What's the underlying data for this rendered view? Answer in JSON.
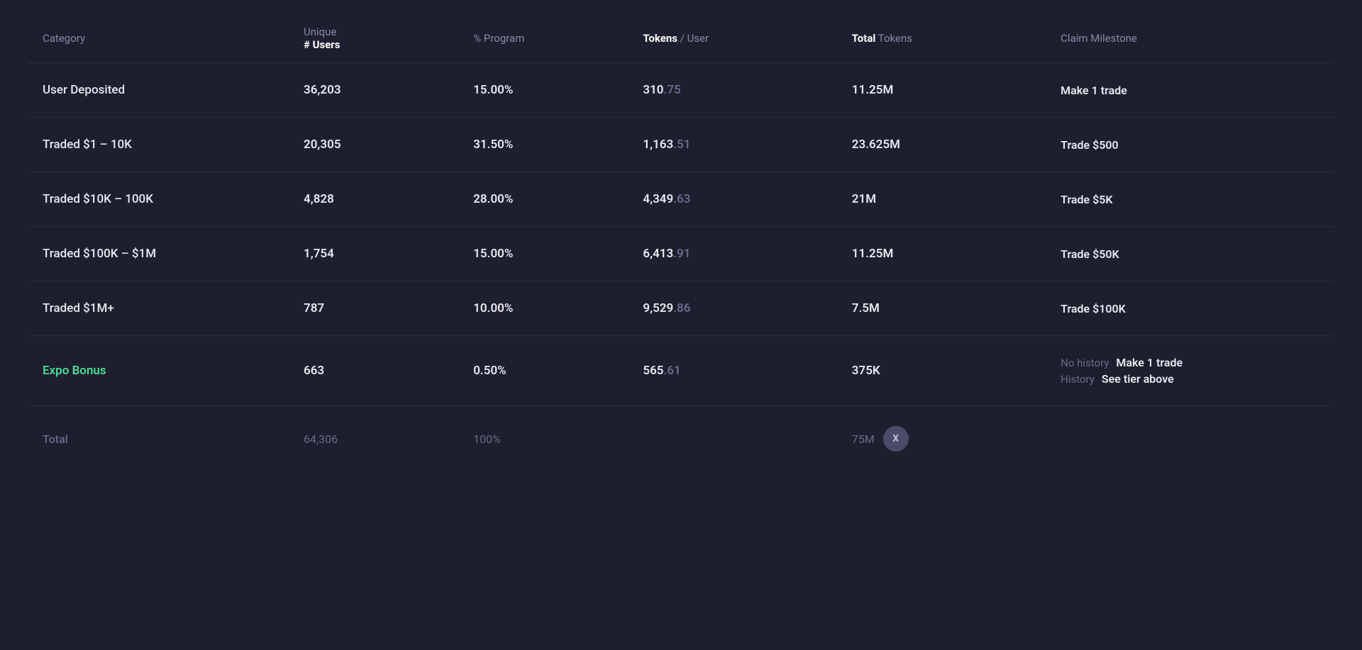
{
  "header": {
    "col1": "Category",
    "col2_line1": "Unique",
    "col2_line2": "# Users",
    "col3": "% Program",
    "col4_bold": "Tokens",
    "col4_rest": " / User",
    "col5_bold": "Total",
    "col5_rest": " Tokens",
    "col6": "Claim Milestone"
  },
  "rows": [
    {
      "category": "User Deposited",
      "isExpo": false,
      "users": "36,203",
      "program": "15.00%",
      "tokens_main": "310",
      "tokens_decimal": ".75",
      "total": "11.25M",
      "milestone": "Make 1 trade",
      "milestone_type": "simple"
    },
    {
      "category": "Traded $1 – 10K",
      "isExpo": false,
      "users": "20,305",
      "program": "31.50%",
      "tokens_main": "1,163",
      "tokens_decimal": ".51",
      "total": "23.625M",
      "milestone": "Trade $500",
      "milestone_type": "simple"
    },
    {
      "category": "Traded $10K – 100K",
      "isExpo": false,
      "users": "4,828",
      "program": "28.00%",
      "tokens_main": "4,349",
      "tokens_decimal": ".63",
      "total": "21M",
      "milestone": "Trade $5K",
      "milestone_type": "simple"
    },
    {
      "category": "Traded $100K – $1M",
      "isExpo": false,
      "users": "1,754",
      "program": "15.00%",
      "tokens_main": "6,413",
      "tokens_decimal": ".91",
      "total": "11.25M",
      "milestone": "Trade $50K",
      "milestone_type": "simple"
    },
    {
      "category": "Traded $1M+",
      "isExpo": false,
      "users": "787",
      "program": "10.00%",
      "tokens_main": "9,529",
      "tokens_decimal": ".86",
      "total": "7.5M",
      "milestone": "Trade $100K",
      "milestone_type": "simple"
    },
    {
      "category": "Expo Bonus",
      "isExpo": true,
      "users": "663",
      "program": "0.50%",
      "tokens_main": "565",
      "tokens_decimal": ".61",
      "total": "375K",
      "milestone_type": "expo",
      "milestone_no_history_label": "No history",
      "milestone_no_history_value": "Make 1 trade",
      "milestone_history_label": "History",
      "milestone_history_value": "See tier above"
    }
  ],
  "total_row": {
    "label": "Total",
    "users": "64,306",
    "program": "100%",
    "total": "75M",
    "badge": "X"
  }
}
